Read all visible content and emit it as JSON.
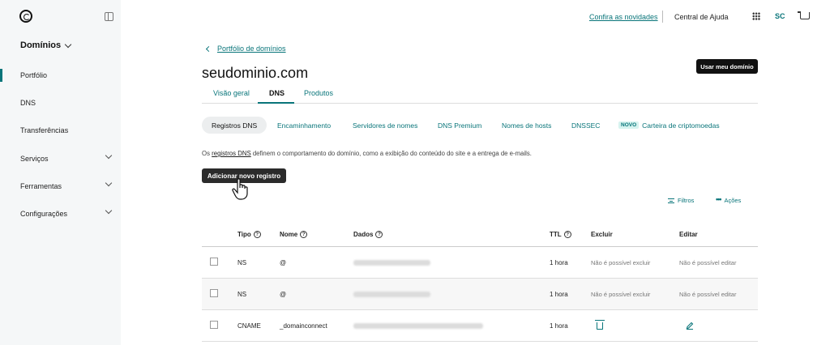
{
  "sidebar": {
    "domains_label": "Domínios",
    "items": [
      {
        "label": "Portfólio"
      },
      {
        "label": "DNS"
      },
      {
        "label": "Transferências"
      },
      {
        "label": "Serviços"
      },
      {
        "label": "Ferramentas"
      },
      {
        "label": "Configurações"
      }
    ]
  },
  "topbar": {
    "whats_new": "Confira as novidades",
    "help": "Central de Ajuda",
    "avatar": "SC"
  },
  "header": {
    "back_link": "Portfólio de domínios",
    "domain": "seudominio.com",
    "use_domain_button": "Usar meu domínio"
  },
  "tabs": [
    {
      "label": "Visão geral"
    },
    {
      "label": "DNS"
    },
    {
      "label": "Produtos"
    }
  ],
  "subtabs": [
    {
      "label": "Registros DNS"
    },
    {
      "label": "Encaminhamento"
    },
    {
      "label": "Servidores de nomes"
    },
    {
      "label": "DNS Premium"
    },
    {
      "label": "Nomes de hosts"
    },
    {
      "label": "DNSSEC"
    },
    {
      "label": "Carteira de criptomoedas",
      "badge": "NOVO"
    }
  ],
  "description": {
    "pre": "Os ",
    "link": "registros DNS",
    "post": " definem o comportamento do domínio, como a exibição do conteúdo do site e a entrega de e-mails."
  },
  "add_record_button": "Adicionar novo registro",
  "toolbar": {
    "filters": "Filtros",
    "actions": "Ações"
  },
  "table": {
    "headers": {
      "type": "Tipo",
      "name": "Nome",
      "data": "Dados",
      "ttl": "TTL",
      "delete": "Excluir",
      "edit": "Editar"
    },
    "rows": [
      {
        "type": "NS",
        "name": "@",
        "ttl": "1 hora",
        "delete": "Não é possível excluir",
        "edit": "Não é possível editar"
      },
      {
        "type": "NS",
        "name": "@",
        "ttl": "1 hora",
        "delete": "Não é possível excluir",
        "edit": "Não é possível editar"
      },
      {
        "type": "CNAME",
        "name": "_domainconnect",
        "ttl": "1 hora",
        "delete": "",
        "edit": ""
      }
    ]
  },
  "colors": {
    "accent": "#09757a",
    "dark_button": "#111111",
    "sidebar_bg": "#f5f7f8"
  }
}
